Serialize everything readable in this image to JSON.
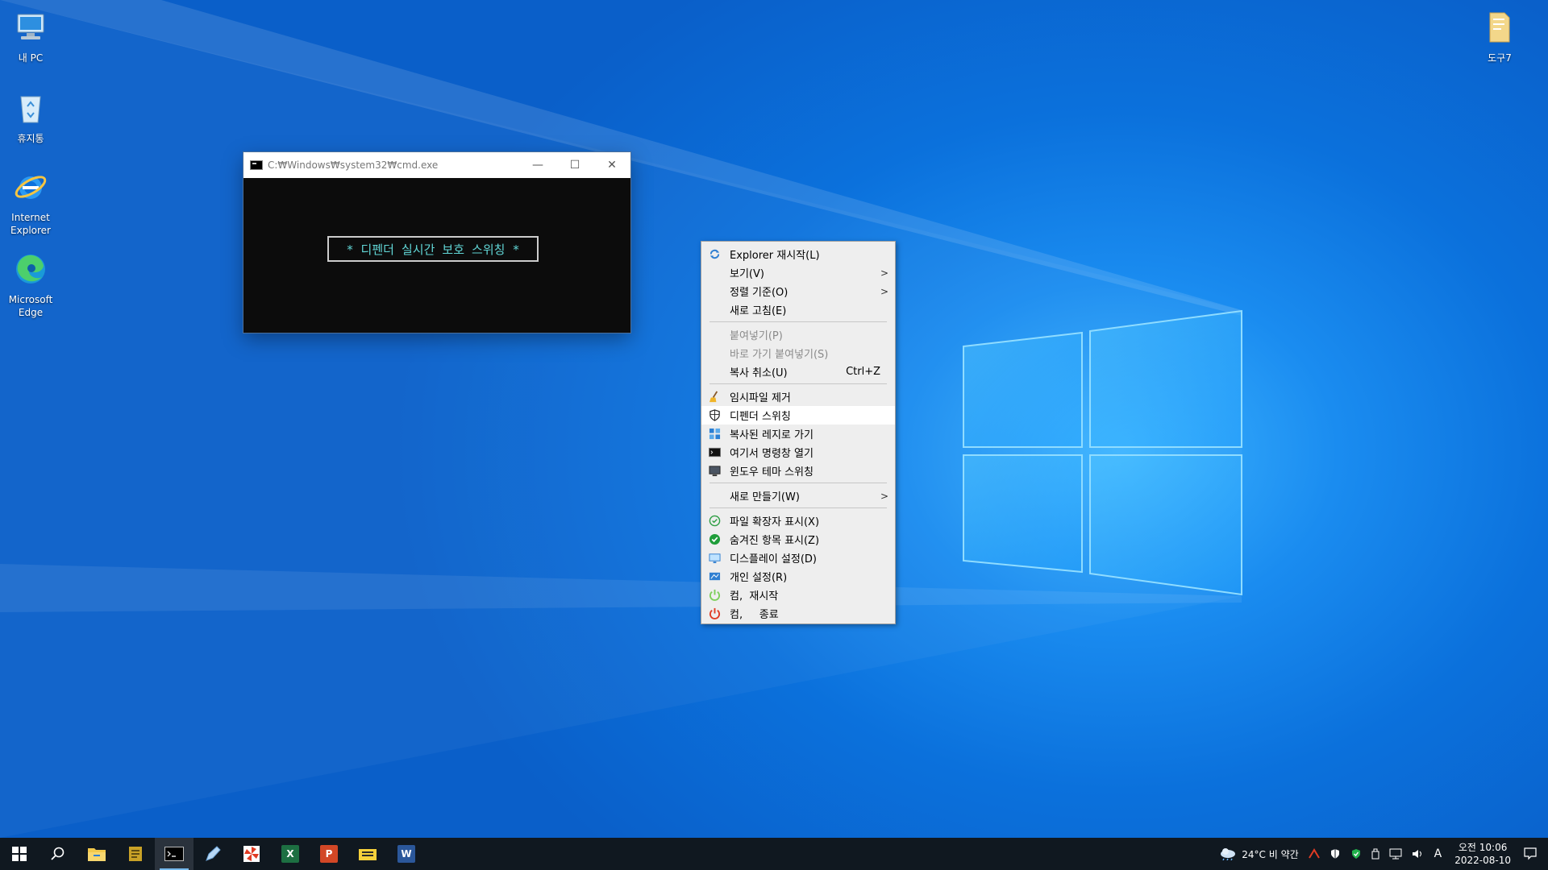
{
  "desktop": {
    "icons_left": [
      {
        "label": "내 PC",
        "icon": "computer-icon"
      },
      {
        "label": "휴지통",
        "icon": "recycle-bin-icon"
      },
      {
        "label": "Internet Explorer",
        "icon": "internet-explorer-icon"
      },
      {
        "label": "Microsoft Edge",
        "icon": "edge-icon"
      }
    ],
    "icon_right": {
      "label": "도구7",
      "icon": "folder-icon"
    }
  },
  "cmd": {
    "title": "C:₩Windows₩system32₩cmd.exe",
    "message": "*  디펜더 실시간 보호 스위칭  *",
    "minimize": "—",
    "maximize": "☐",
    "close": "✕"
  },
  "context_menu": {
    "items": [
      {
        "label": "Explorer 재시작(L)",
        "icon": "refresh-icon"
      },
      {
        "label": "보기(V)",
        "submenu": true
      },
      {
        "label": "정렬 기준(O)",
        "submenu": true
      },
      {
        "label": "새로 고침(E)"
      },
      {
        "label": "붙여넣기(P)",
        "disabled": true
      },
      {
        "label": "바로 가기 붙여넣기(S)",
        "disabled": true
      },
      {
        "label": "복사 취소(U)",
        "accelerator": "Ctrl+Z"
      },
      {
        "label": "임시파일 제거",
        "icon": "broom-icon"
      },
      {
        "label": "디펜더 스위칭",
        "icon": "shield-icon",
        "hover": true
      },
      {
        "label": "복사된 레지로 가기",
        "icon": "registry-icon"
      },
      {
        "label": "여기서 명령창 열기",
        "icon": "cmd-icon"
      },
      {
        "label": "윈도우 테마 스위칭",
        "icon": "monitor-icon"
      },
      {
        "label": "새로 만들기(W)",
        "submenu": true
      },
      {
        "label": "파일 확장자 표시(X)",
        "icon": "check-outline-icon"
      },
      {
        "label": "숨겨진 항목 표시(Z)",
        "icon": "check-filled-icon"
      },
      {
        "label": "디스플레이 설정(D)",
        "icon": "display-icon"
      },
      {
        "label": "개인 설정(R)",
        "icon": "personalize-icon"
      },
      {
        "label": "컴,  재시작",
        "icon": "restart-icon"
      },
      {
        "label": "컴,     종료",
        "icon": "power-icon"
      }
    ]
  },
  "taskbar": {
    "apps": [
      {
        "name": "start-button",
        "icon": "windows-logo-icon"
      },
      {
        "name": "search-button",
        "icon": "search-icon"
      },
      {
        "name": "file-explorer",
        "icon": "folder-icon"
      },
      {
        "name": "app-notepad",
        "icon": "notepad-icon"
      },
      {
        "name": "app-cmd",
        "icon": "cmd-icon",
        "active": true
      },
      {
        "name": "app-edit",
        "icon": "pen-icon"
      },
      {
        "name": "app-pinwheel",
        "icon": "pinwheel-icon"
      },
      {
        "name": "app-excel",
        "icon": "excel-icon",
        "glyph": "X"
      },
      {
        "name": "app-powerpoint",
        "icon": "powerpoint-icon",
        "glyph": "P"
      },
      {
        "name": "app-bandizip",
        "icon": "archive-icon"
      },
      {
        "name": "app-word",
        "icon": "word-icon",
        "glyph": "W"
      }
    ],
    "weather": "24°C  비 약간",
    "ime": "A",
    "clock_time": "오전 10:06",
    "clock_date": "2022-08-10"
  },
  "colors": {
    "accent": "#0078d7",
    "cmd_text": "#61d6d6",
    "menu_bg": "#eeeeee",
    "taskbar_bg": "#101820"
  }
}
